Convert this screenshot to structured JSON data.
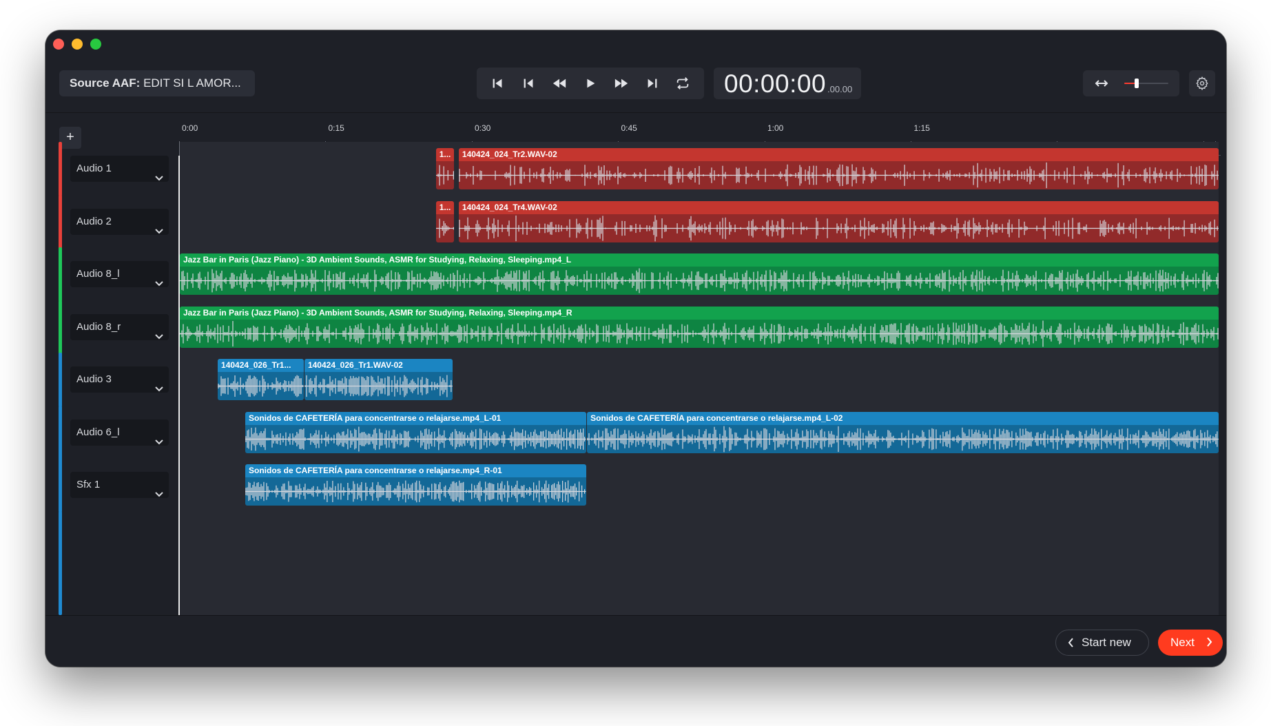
{
  "window": {
    "title_source_label": "Source AAF:",
    "title_source_value": "EDIT SI L AMOR..."
  },
  "transport": {
    "buttons": [
      "skip-to-start",
      "step-back",
      "rewind",
      "play",
      "fast-forward",
      "step-forward",
      "loop"
    ]
  },
  "timecode": {
    "main": "00:00:00",
    "fraction": ".00.00"
  },
  "zoom": {
    "level": 0.28
  },
  "ruler": {
    "labels": [
      "0:00",
      "0:15",
      "0:30",
      "0:45",
      "1:00",
      "1:15"
    ]
  },
  "add_track_label": "+",
  "tracks": [
    {
      "name": "Audio 1",
      "color": "red",
      "accent": "#e8413a",
      "clips": [
        {
          "label": "1...",
          "start": 0.2465,
          "end": 0.264
        },
        {
          "label": "140424_024_Tr2.WAV-02",
          "start": 0.2685,
          "end": 1.0
        }
      ]
    },
    {
      "name": "Audio 2",
      "color": "red",
      "accent": "#e8413a",
      "clips": [
        {
          "label": "1...",
          "start": 0.2465,
          "end": 0.264
        },
        {
          "label": "140424_024_Tr4.WAV-02",
          "start": 0.2685,
          "end": 1.0
        }
      ]
    },
    {
      "name": "Audio 8_l",
      "color": "green",
      "accent": "#1fc85a",
      "clips": [
        {
          "label": "Jazz Bar in Paris (Jazz Piano) - 3D Ambient Sounds, ASMR for Studying, Relaxing, Sleeping.mp4_L",
          "start": 0.0,
          "end": 1.0
        }
      ]
    },
    {
      "name": "Audio 8_r",
      "color": "green",
      "accent": "#1fc85a",
      "clips": [
        {
          "label": "Jazz Bar in Paris (Jazz Piano) - 3D Ambient Sounds, ASMR for Studying, Relaxing, Sleeping.mp4_R",
          "start": 0.0,
          "end": 1.0
        }
      ]
    },
    {
      "name": "Audio 3",
      "color": "blue",
      "accent": "#1f8ad1",
      "clips": [
        {
          "label": "140424_026_Tr1...",
          "start": 0.0365,
          "end": 0.1195
        },
        {
          "label": "140424_026_Tr1.WAV-02",
          "start": 0.12,
          "end": 0.2625
        }
      ]
    },
    {
      "name": "Audio 6_l",
      "color": "blue",
      "accent": "#1f8ad1",
      "clips": [
        {
          "label": "Sonidos de CAFETERÍA para concentrarse o relajarse.mp4_L-01",
          "start": 0.063,
          "end": 0.391
        },
        {
          "label": "Sonidos de CAFETERÍA para concentrarse o relajarse.mp4_L-02",
          "start": 0.392,
          "end": 1.0
        }
      ]
    },
    {
      "name": "Sfx 1",
      "color": "blue",
      "accent": "#1f8ad1",
      "clips": [
        {
          "label": "Sonidos de CAFETERÍA para concentrarse o relajarse.mp4_R-01",
          "start": 0.063,
          "end": 0.391
        }
      ]
    }
  ],
  "footer": {
    "start_new_label": "Start new",
    "next_label": "Next"
  }
}
